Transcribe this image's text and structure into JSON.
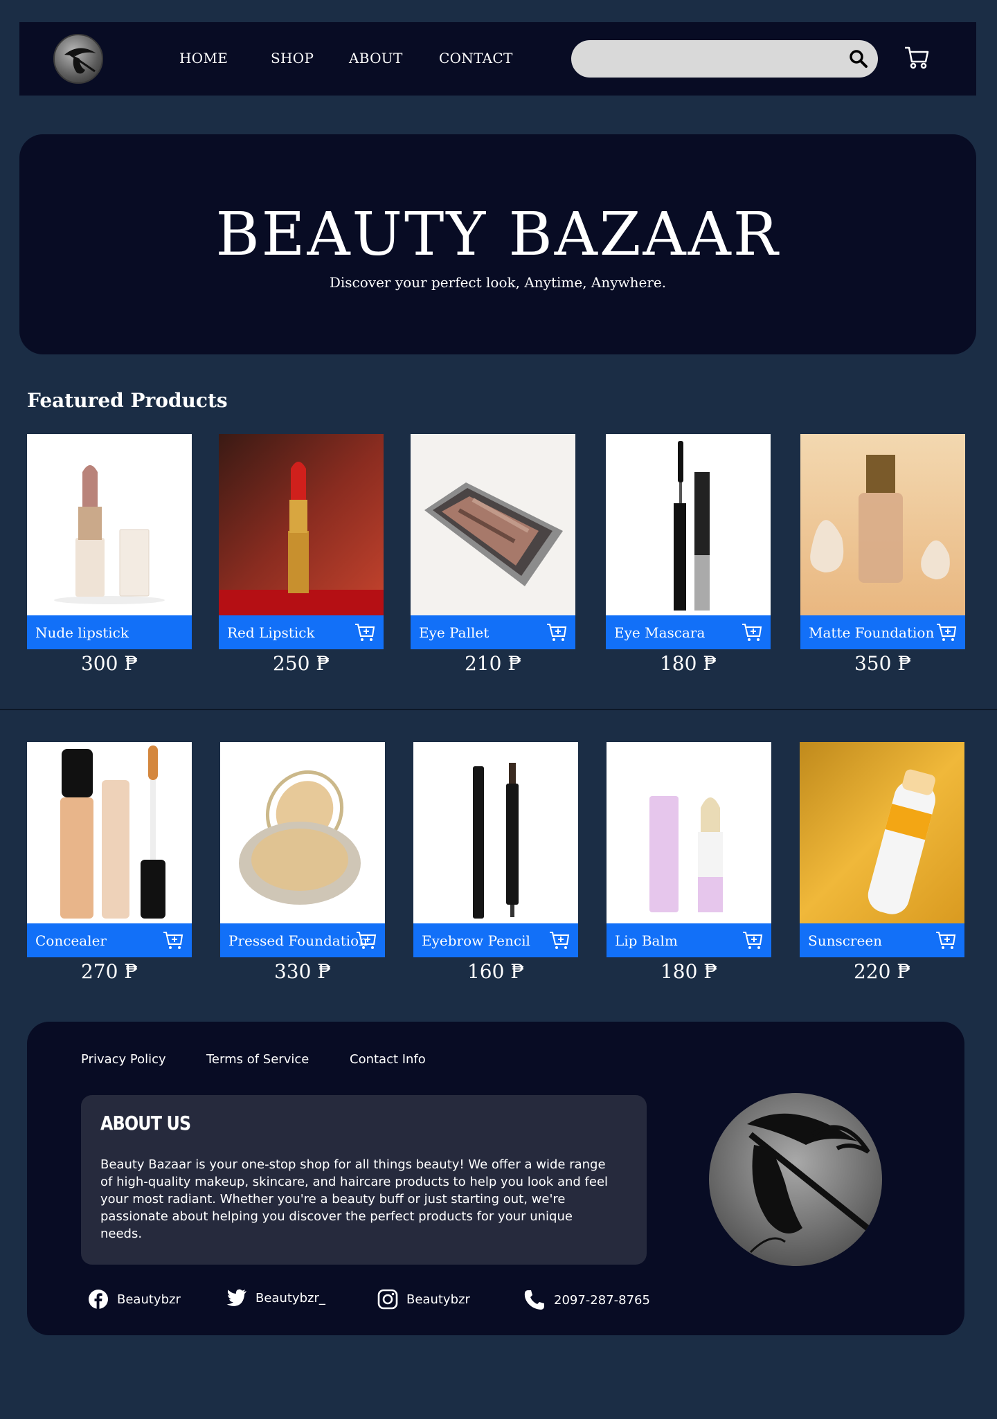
{
  "nav": {
    "links": [
      "HOME",
      "SHOP",
      "ABOUT",
      "CONTACT"
    ],
    "search_placeholder": ""
  },
  "hero": {
    "title": "BEAUTY BAZAAR",
    "subtitle": "Discover your perfect look, Anytime, Anywhere."
  },
  "featured": {
    "title": "Featured Products",
    "products": [
      {
        "name": "Nude lipstick",
        "price": "300 ₱"
      },
      {
        "name": "Red Lipstick",
        "price": "250 ₱"
      },
      {
        "name": "Eye Pallet",
        "price": "210 ₱"
      },
      {
        "name": "Eye Mascara",
        "price": "180 ₱"
      },
      {
        "name": "Matte Foundation",
        "price": "350 ₱"
      },
      {
        "name": "Concealer",
        "price": "270 ₱"
      },
      {
        "name": "Pressed Foundation",
        "price": "330 ₱"
      },
      {
        "name": "Eyebrow Pencil",
        "price": "160 ₱"
      },
      {
        "name": "Lip Balm",
        "price": "180 ₱"
      },
      {
        "name": "Sunscreen",
        "price": "220 ₱"
      }
    ]
  },
  "footer": {
    "links": [
      "Privacy Policy",
      "Terms of Service",
      "Contact Info"
    ],
    "about_title": "ABOUT US",
    "about_text": "Beauty Bazaar is your one-stop shop for all things beauty! We offer a wide range of high-quality makeup, skincare, and haircare products to help you look and feel your most radiant. Whether you're a beauty buff or just starting out, we're passionate about helping you discover the perfect products for your unique needs.",
    "social": {
      "facebook": "Beautybzr",
      "twitter": "Beautybzr_",
      "instagram": "Beautybzr",
      "phone": "2097-287-8765"
    }
  },
  "colors": {
    "page_bg": "#1b2d45",
    "panel_bg": "#080c24",
    "accent": "#1270f8",
    "about_bg": "#262a3d"
  },
  "icons": [
    "logo-woman-hat-icon",
    "search-icon",
    "cart-icon",
    "add-to-cart-icon",
    "facebook-icon",
    "twitter-icon",
    "instagram-icon",
    "phone-icon"
  ]
}
